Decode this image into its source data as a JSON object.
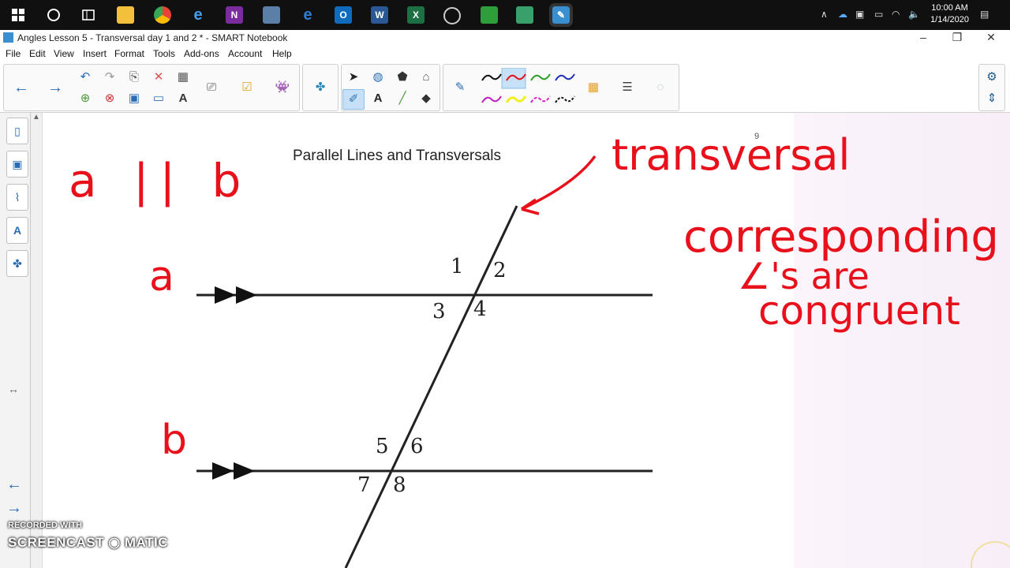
{
  "taskbar": {
    "time": "10:00 AM",
    "date": "1/14/2020",
    "apps": [
      "windows-start",
      "cortana",
      "task-view",
      "file-explorer",
      "chrome",
      "internet-explorer",
      "onenote",
      "remote-desktop",
      "edge",
      "outlook",
      "word",
      "excel",
      "obs",
      "greenshot",
      "camtasia",
      "smart-notebook"
    ]
  },
  "window": {
    "title": "Angles Lesson 5 - Transversal day 1 and 2 * - SMART Notebook"
  },
  "menu": [
    "File",
    "Edit",
    "View",
    "Insert",
    "Format",
    "Tools",
    "Add-ons",
    "Account",
    "Help"
  ],
  "page": {
    "title": "Parallel Lines and Transversals",
    "page_number": "9",
    "angle_labels": [
      "1",
      "2",
      "3",
      "4",
      "5",
      "6",
      "7",
      "8"
    ],
    "handwriting": {
      "parallel": "a || b",
      "line_a": "a",
      "line_b": "b",
      "transversal": "transversal",
      "note1": "corresponding",
      "note2": "∠'s are",
      "note3": "congruent"
    },
    "ink_color": "#e8101a"
  },
  "watermark": {
    "line1": "RECORDED WITH",
    "line2": "SCREENCAST ◉ MATIC"
  }
}
